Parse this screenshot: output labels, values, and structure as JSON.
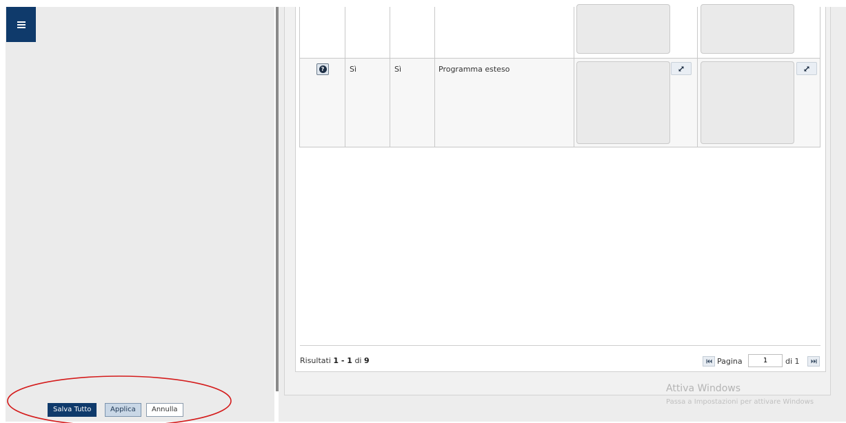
{
  "grid": {
    "row": {
      "col_b": "Sì",
      "col_c": "Sì",
      "col_d": "Programma esteso"
    }
  },
  "pager": {
    "results_label": "Risultati",
    "results_range": "1 - 1",
    "results_of": "di",
    "results_total": "9",
    "page_label": "Pagina",
    "page_value": "1",
    "page_of": "di 1"
  },
  "actions": {
    "save_all": "Salva Tutto",
    "apply": "Applica",
    "cancel": "Annulla"
  },
  "watermark": {
    "title": "Attiva Windows",
    "subtitle": "Passa a Impostazioni per attivare Windows"
  },
  "colors": {
    "primary": "#0f3a6b",
    "highlight": "#d41b1b"
  }
}
